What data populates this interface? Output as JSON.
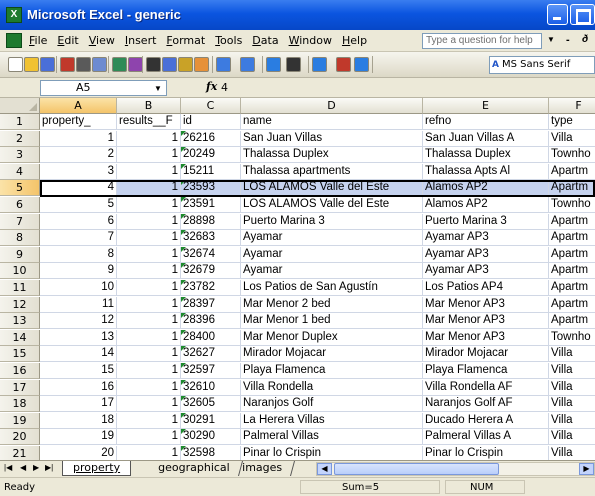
{
  "window": {
    "title": "Microsoft Excel - generic",
    "app_icon": "excel-icon"
  },
  "menu": {
    "items": [
      "File",
      "Edit",
      "View",
      "Insert",
      "Format",
      "Tools",
      "Data",
      "Window",
      "Help"
    ],
    "ask_placeholder": "Type a question for help",
    "restore_glyph": "ð"
  },
  "toolbar": {
    "font_name": "MS Sans Serif",
    "icons": [
      "new-icon",
      "open-icon",
      "save-icon",
      "permission-icon",
      "print-icon",
      "print-preview-icon",
      "spelling-icon",
      "research-icon",
      "cut-icon",
      "copy-icon",
      "paste-icon",
      "format-painter-icon",
      "undo-icon",
      "redo-icon",
      "hyperlink-icon",
      "autosum-icon",
      "sort-ascending-icon",
      "chart-wizard-icon",
      "help-icon"
    ]
  },
  "formula_bar": {
    "name_box": "A5",
    "fx_label": "fx",
    "value": "4"
  },
  "columns": [
    "A",
    "B",
    "C",
    "D",
    "E",
    "F"
  ],
  "active_cell": {
    "column": "A",
    "row": "5"
  },
  "rows": [
    {
      "n": "1",
      "a": "property_",
      "b": "results__F",
      "c": "id",
      "d": "name",
      "e": "refno",
      "f": "type",
      "header": true
    },
    {
      "n": "2",
      "a": "1",
      "b": "1",
      "c": "26216",
      "d": "San Juan Villas",
      "e": "San Juan Villas A",
      "f": "Villa"
    },
    {
      "n": "3",
      "a": "2",
      "b": "1",
      "c": "20249",
      "d": "Thalassa Duplex",
      "e": "Thalassa Duplex",
      "f": "Townho"
    },
    {
      "n": "4",
      "a": "3",
      "b": "1",
      "c": "15211",
      "d": "Thalassa apartments",
      "e": "Thalassa Apts Al",
      "f": "Apartm"
    },
    {
      "n": "5",
      "a": "4",
      "b": "1",
      "c": "23593",
      "d": "LOS ALAMOS Valle del Este",
      "e": "Alamos AP2",
      "f": "Apartm",
      "active": true
    },
    {
      "n": "6",
      "a": "5",
      "b": "1",
      "c": "23591",
      "d": "LOS ALAMOS Valle del Este",
      "e": "Alamos  AP2",
      "f": "Townho"
    },
    {
      "n": "7",
      "a": "6",
      "b": "1",
      "c": "28898",
      "d": "Puerto Marina 3",
      "e": "Puerto Marina 3",
      "f": "Apartm"
    },
    {
      "n": "8",
      "a": "7",
      "b": "1",
      "c": "32683",
      "d": "Ayamar",
      "e": "Ayamar AP3",
      "f": "Apartm"
    },
    {
      "n": "9",
      "a": "8",
      "b": "1",
      "c": "32674",
      "d": "Ayamar",
      "e": "Ayamar AP3",
      "f": "Apartm"
    },
    {
      "n": "10",
      "a": "9",
      "b": "1",
      "c": "32679",
      "d": "Ayamar",
      "e": "Ayamar AP3",
      "f": "Apartm"
    },
    {
      "n": "11",
      "a": "10",
      "b": "1",
      "c": "23782",
      "d": "Los Patios de San Agustín",
      "e": "Los Patios AP4",
      "f": "Apartm"
    },
    {
      "n": "12",
      "a": "11",
      "b": "1",
      "c": "28397",
      "d": "Mar Menor 2 bed",
      "e": "Mar Menor AP3",
      "f": "Apartm"
    },
    {
      "n": "13",
      "a": "12",
      "b": "1",
      "c": "28396",
      "d": "Mar Menor 1 bed",
      "e": "Mar Menor AP3",
      "f": "Apartm"
    },
    {
      "n": "14",
      "a": "13",
      "b": "1",
      "c": "28400",
      "d": "Mar Menor Duplex",
      "e": "Mar Menor AP3",
      "f": "Townho"
    },
    {
      "n": "15",
      "a": "14",
      "b": "1",
      "c": "32627",
      "d": "Mirador Mojacar",
      "e": "Mirador Mojacar",
      "f": "Villa"
    },
    {
      "n": "16",
      "a": "15",
      "b": "1",
      "c": "32597",
      "d": "Playa Flamenca",
      "e": "Playa Flamenca",
      "f": "Villa"
    },
    {
      "n": "17",
      "a": "16",
      "b": "1",
      "c": "32610",
      "d": "Villa Rondella",
      "e": "Villa Rondella AF",
      "f": "Villa"
    },
    {
      "n": "18",
      "a": "17",
      "b": "1",
      "c": "32605",
      "d": "Naranjos Golf",
      "e": "Naranjos Golf AF",
      "f": "Villa"
    },
    {
      "n": "19",
      "a": "18",
      "b": "1",
      "c": "30291",
      "d": "La Herera Villas",
      "e": "Ducado Herera A",
      "f": "Villa"
    },
    {
      "n": "20",
      "a": "19",
      "b": "1",
      "c": "30290",
      "d": "Palmeral Villas",
      "e": "Palmeral Villas A",
      "f": "Villa"
    },
    {
      "n": "21",
      "a": "20",
      "b": "1",
      "c": "32598",
      "d": "Pinar lo Crispin",
      "e": "Pinar lo Crispin",
      "f": "Villa"
    }
  ],
  "sheet_tabs": {
    "active": "property",
    "others": [
      "geographical",
      "images"
    ]
  },
  "status": {
    "ready": "Ready",
    "sum": "Sum=5",
    "num": "NUM"
  },
  "colors": {
    "title_bar": "#0b55e0",
    "selection": "#c6d3ef",
    "active_header": "#f4c46a",
    "error_flag": "#1e8a2e"
  }
}
